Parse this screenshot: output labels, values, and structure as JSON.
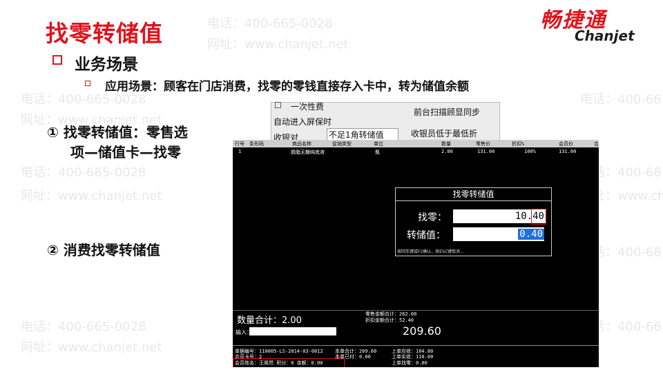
{
  "slide": {
    "title": "找零转储值",
    "brand_cn": "畅捷通",
    "brand_en": "Chanjet",
    "section_title": "业务场景",
    "scenario": "应用场景：顾客在门店消费，找零的零钱直接存入卡中，转为储值余额",
    "step1_line1": "① 找零转储值：零售选",
    "step1_line2": "项—储值卡—找零",
    "step2": "② 消费找零转储值",
    "watermark_phone": "电话：400-665-0028",
    "watermark_site": "网址：www.chanjet.net"
  },
  "popup": {
    "item_checkbox": "一次性费",
    "auto_screen": "自动进入屏保时",
    "receipt_pair": "收银对",
    "round_option": "不足1角转储值",
    "scan_option": "前台扫描顾显同步",
    "cashier_option": "收银员低于最低折"
  },
  "pos": {
    "headers": [
      "行号",
      "条形码",
      "商品名称",
      "促销类型",
      "单位",
      "数量",
      "零售价",
      "折扣%",
      "会员价",
      "合"
    ],
    "row": [
      "1",
      "",
      "脱脂无糖纯底液",
      "",
      "瓶",
      "2.00",
      "131.00",
      "100%",
      "131.00"
    ],
    "dialog_title": "找零转储值",
    "change_label": "找零：",
    "change_value": "10.40",
    "stored_label": "转储值：",
    "stored_value": "0.40",
    "hint": "按回车键或F2确认，按ESC键取消...",
    "qty_total": "数量合计：2.00",
    "retail_total": "零售金额合计：262.00",
    "discount_total": "折扣金额合计：52.40",
    "input_label": "输入：",
    "grand_total": "209.60",
    "bill_no": "单据编号：110005-LS-2014-03-0012",
    "member_no": "会员卡号：2",
    "member_name": "会员姓名：王昊然  积分：0  余额：0.00",
    "this_total": "本单合计：209.60",
    "this_paid": "本单已付：0.00",
    "last_due": "上单应收：104.80",
    "last_recv": "上单实收：110.00",
    "last_change": "上单找零：0.00"
  },
  "colors": {
    "accent": "#e0121c",
    "pos_bg": "#000000",
    "field_sel": "#1e6fd9"
  }
}
